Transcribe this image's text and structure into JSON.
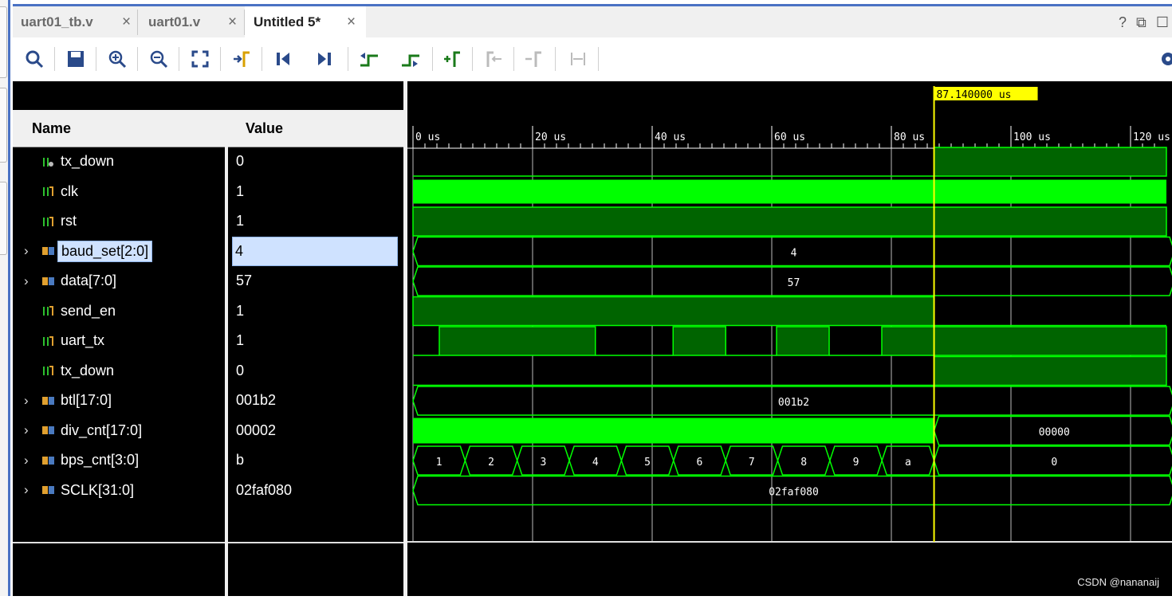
{
  "tabs": [
    {
      "label": "uart01_tb.v",
      "close": "×"
    },
    {
      "label": "uart01.v",
      "close": "×"
    },
    {
      "label": "Untitled 5*",
      "close": "×"
    }
  ],
  "window_controls": {
    "help": "?",
    "restore": "⧉",
    "maximize": "☐"
  },
  "toolbar": {
    "icons": [
      "search-icon",
      "save-icon",
      "zoom-in-icon",
      "zoom-out-icon",
      "zoom-fit-icon",
      "go-to-cursor-icon",
      "go-to-start-icon",
      "go-to-end-icon",
      "previous-transition-icon",
      "next-transition-icon",
      "add-marker-icon",
      "previous-marker-icon",
      "next-marker-icon",
      "swap-cursors-icon",
      "settings-icon"
    ]
  },
  "columns": {
    "name": "Name",
    "value": "Value"
  },
  "signals": [
    {
      "name": "tx_down",
      "value": "0",
      "expandable": false,
      "icon": "input-signal-icon"
    },
    {
      "name": "clk",
      "value": "1",
      "expandable": false,
      "icon": "signal-icon"
    },
    {
      "name": "rst",
      "value": "1",
      "expandable": false,
      "icon": "signal-icon"
    },
    {
      "name": "baud_set[2:0]",
      "value": "4",
      "expandable": true,
      "icon": "bus-icon",
      "selected": true
    },
    {
      "name": "data[7:0]",
      "value": "57",
      "expandable": true,
      "icon": "bus-icon"
    },
    {
      "name": "send_en",
      "value": "1",
      "expandable": false,
      "icon": "signal-icon"
    },
    {
      "name": "uart_tx",
      "value": "1",
      "expandable": false,
      "icon": "signal-icon"
    },
    {
      "name": "tx_down",
      "value": "0",
      "expandable": false,
      "icon": "signal-icon"
    },
    {
      "name": "btl[17:0]",
      "value": "001b2",
      "expandable": true,
      "icon": "bus-icon"
    },
    {
      "name": "div_cnt[17:0]",
      "value": "00002",
      "expandable": true,
      "icon": "bus-icon"
    },
    {
      "name": "bps_cnt[3:0]",
      "value": "b",
      "expandable": true,
      "icon": "bus-icon"
    },
    {
      "name": "SCLK[31:0]",
      "value": "02faf080",
      "expandable": true,
      "icon": "bus-icon"
    }
  ],
  "waveform": {
    "cursor_label": "87.140000 us",
    "cursor_time": 87.14,
    "time_range": [
      0,
      126
    ],
    "ticks": [
      "0 us",
      "20 us",
      "40 us",
      "60 us",
      "80 us",
      "100 us",
      "120 us"
    ],
    "colors": {
      "wave": "#00ff00",
      "wave_fill": "#006400",
      "cursor": "#ffff00",
      "grid": "#ffffff"
    },
    "baud_set_value": "4",
    "data_value": "57",
    "btl_value": "001b2",
    "div_cnt_after": "00000",
    "bps_cnt_segments": [
      "1",
      "2",
      "3",
      "4",
      "5",
      "6",
      "7",
      "8",
      "9",
      "a",
      "0"
    ],
    "sclk_value": "02faf080"
  },
  "watermark": "CSDN @nananaij"
}
